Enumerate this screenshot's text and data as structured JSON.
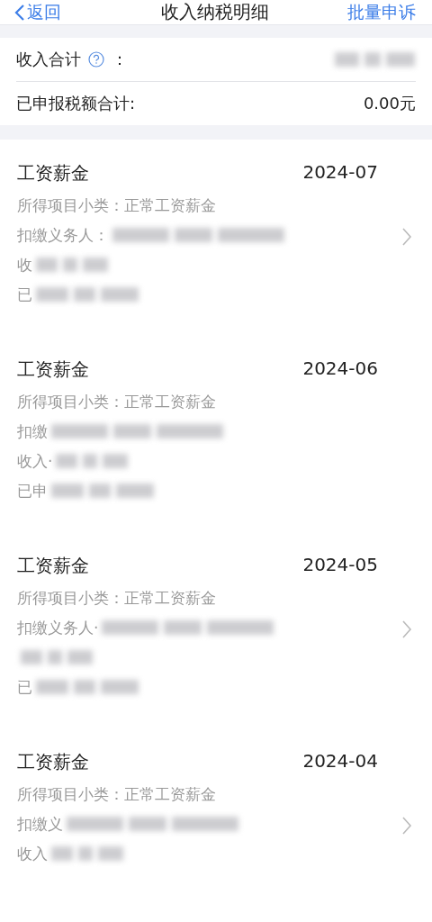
{
  "nav": {
    "back": "返回",
    "title": "收入纳税明细",
    "action": "批量申诉"
  },
  "summary": [
    {
      "label": "收入合计",
      "help": true,
      "colon": "：",
      "blurred": true
    },
    {
      "label": "已申报税额合计:",
      "help": false,
      "blurred": false,
      "value": "0.00元"
    }
  ],
  "records": [
    {
      "title": "工资薪金",
      "period": "2024-07",
      "subtype": "所得项目小类：正常工资薪金",
      "chevron": true,
      "lines": [
        {
          "label": "扣缴义务人：",
          "blurred": true
        },
        {
          "label": "收",
          "blurred": true
        },
        {
          "label": "已",
          "blurred": true
        }
      ]
    },
    {
      "title": "工资薪金",
      "period": "2024-06",
      "subtype": "所得项目小类：正常工资薪金",
      "chevron": false,
      "lines": [
        {
          "label": "扣缴",
          "blurred": true
        },
        {
          "label": "收入·",
          "blurred": true
        },
        {
          "label": "已申",
          "blurred": true
        }
      ]
    },
    {
      "title": "工资薪金",
      "period": "2024-05",
      "subtype": "所得项目小类：正常工资薪金",
      "chevron": true,
      "lines": [
        {
          "label": "扣缴义务人·",
          "blurred": true
        },
        {
          "blurred": true
        },
        {
          "label": "已",
          "blurred": true
        }
      ]
    },
    {
      "title": "工资薪金",
      "period": "2024-04",
      "subtype": "所得项目小类：正常工资薪金",
      "chevron": true,
      "lines": [
        {
          "label": "扣缴义",
          "blurred": true
        },
        {
          "label": "收入",
          "blurred": true
        }
      ]
    }
  ]
}
